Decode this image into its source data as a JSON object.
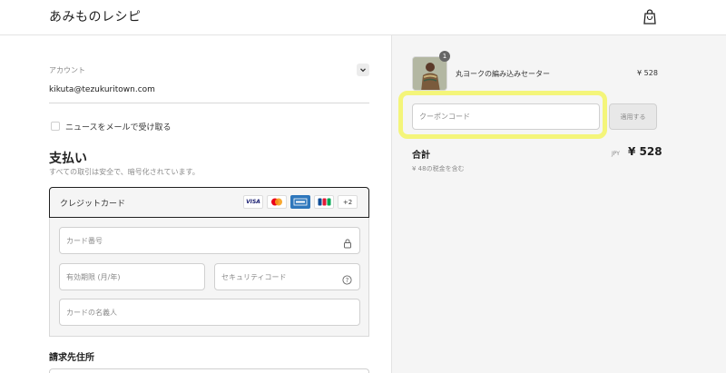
{
  "header": {
    "brand": "あみものレシピ",
    "bag_icon": "shopping-bag-icon"
  },
  "account": {
    "label": "アカウント",
    "email": "kikuta@tezukuritown.com",
    "toggle_icon": "chevron-down-icon"
  },
  "newsletter": {
    "label": "ニュースをメールで受け取る",
    "checked": false
  },
  "payment": {
    "title": "支払い",
    "subtitle": "すべての取引は安全で、暗号化されています。",
    "method_label": "クレジットカード",
    "brands": [
      "VISA",
      "mastercard",
      "AMERICAN EXPRESS",
      "JCB",
      "+2"
    ],
    "card_number_placeholder": "カード番号",
    "expiry_placeholder": "有効期限 (月/年)",
    "security_placeholder": "セキュリティコード",
    "name_placeholder": "カードの名義人"
  },
  "billing": {
    "title": "請求先住所"
  },
  "order": {
    "item_name": "丸ヨークの編み込みセーター",
    "item_price": "¥ 528",
    "item_quantity": "1",
    "coupon_placeholder": "クーポンコード",
    "apply_label": "適用する",
    "total_label": "合計",
    "tax_note": "¥ 48の税金を含む",
    "currency": "JPY",
    "total_price": "¥ 528"
  },
  "colors": {
    "highlight": "#f4f57a",
    "pane_bg": "#f5f5f5",
    "amex_blue": "#2e77bc",
    "jcb_blue": "#0e4c96"
  }
}
